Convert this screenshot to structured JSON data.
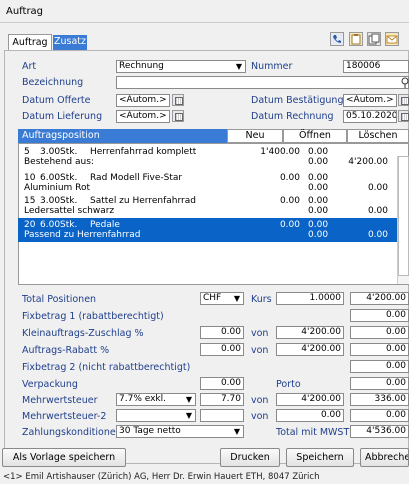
{
  "window_title": "Auftrag",
  "tabs": [
    {
      "label": "Auftrag"
    },
    {
      "label": "Zusatz"
    }
  ],
  "form": {
    "art_label": "Art",
    "art_value": "Rechnung",
    "nummer_label": "Nummer",
    "nummer_value": "180006",
    "bezeichnung_label": "Bezeichnung",
    "bezeichnung_value": "",
    "datum_offerte_label": "Datum Offerte",
    "datum_offerte_value": "<Autom.>",
    "datum_bestaetigung_label": "Datum Bestätigung",
    "datum_bestaetigung_value": "<Autom.>",
    "datum_lieferung_label": "Datum Lieferung",
    "datum_lieferung_value": "<Autom.>",
    "datum_rechnung_label": "Datum Rechnung",
    "datum_rechnung_value": "05.10.2020"
  },
  "positions": {
    "header": "Auftragsposition",
    "btn_neu": "Neu",
    "btn_oeffnen": "Öffnen",
    "btn_loeschen": "Löschen",
    "rows": [
      {
        "nr": "5",
        "qty": "3.00Stk.",
        "name": "Herrenfahrrad komplett",
        "desc": "Bestehend aus:",
        "price": "1'400.00",
        "v1": "0.00",
        "v2": "0.00",
        "total": "4'200.00",
        "selected": false
      },
      {
        "nr": "10",
        "qty": "6.00Stk.",
        "name": "Rad Modell Five-Star",
        "desc": "Aluminium Rot",
        "price": "0.00",
        "v1": "0.00",
        "v2": "0.00",
        "total": "0.00",
        "selected": false
      },
      {
        "nr": "15",
        "qty": "3.00Stk.",
        "name": "Sattel zu Herrenfahrrad",
        "desc": "Ledersattel schwarz",
        "price": "0.00",
        "v1": "0.00",
        "v2": "0.00",
        "total": "0.00",
        "selected": false
      },
      {
        "nr": "20",
        "qty": "6.00Stk.",
        "name": "Pedale",
        "desc": "Passend zu Herrenfahrrad",
        "price": "0.00",
        "v1": "0.00",
        "v2": "0.00",
        "total": "0.00",
        "selected": true
      }
    ]
  },
  "totals": {
    "total_positionen_label": "Total Positionen",
    "currency": "CHF",
    "kurs_label": "Kurs",
    "kurs_value": "1.0000",
    "total_positionen_value": "4'200.00",
    "fixbetrag1_label": "Fixbetrag 1 (rabattberechtigt)",
    "fixbetrag1_value": "0.00",
    "klein_label": "Kleinauftrags-Zuschlag %",
    "klein_pct": "0.00",
    "klein_von_label": "von",
    "klein_von": "4'200.00",
    "klein_value": "0.00",
    "rabatt_label": "Auftrags-Rabatt %",
    "rabatt_pct": "0.00",
    "rabatt_von_label": "von",
    "rabatt_von": "4'200.00",
    "rabatt_value": "0.00",
    "fixbetrag2_label": "Fixbetrag 2 (nicht rabattberechtigt)",
    "fixbetrag2_value": "0.00",
    "verpackung_label": "Verpackung",
    "verpackung_value": "0.00",
    "porto_label": "Porto",
    "porto_value": "0.00",
    "mwst_label": "Mehrwertsteuer",
    "mwst_select": "7.7% exkl.",
    "mwst_pct": "7.70",
    "mwst_von_label": "von",
    "mwst_von": "4'200.00",
    "mwst_value": "336.00",
    "mwst2_label": "Mehrwertsteuer-2",
    "mwst2_select": "",
    "mwst2_pct": "",
    "mwst2_von_label": "von",
    "mwst2_von": "0.00",
    "mwst2_value": "0.00",
    "zahlung_label": "Zahlungskonditionen",
    "zahlung_value": "30 Tage netto",
    "total_mwst_label": "Total mit MWST",
    "total_mwst_value": "4'536.00"
  },
  "buttons": {
    "vorlage": "Als Vorlage speichern",
    "drucken": "Drucken",
    "speichern": "Speichern",
    "abbrechen": "Abbreche"
  },
  "status": "<1> Emil Artishauser (Zürich) AG, Herr Dr. Erwin Hauert ETH, 8047 Zürich",
  "colors": {
    "selection": "#0a64c8",
    "header_bar": "#3a7bd5",
    "art_highlight": "#ffff66",
    "label_blue": "#1f3f8c"
  }
}
